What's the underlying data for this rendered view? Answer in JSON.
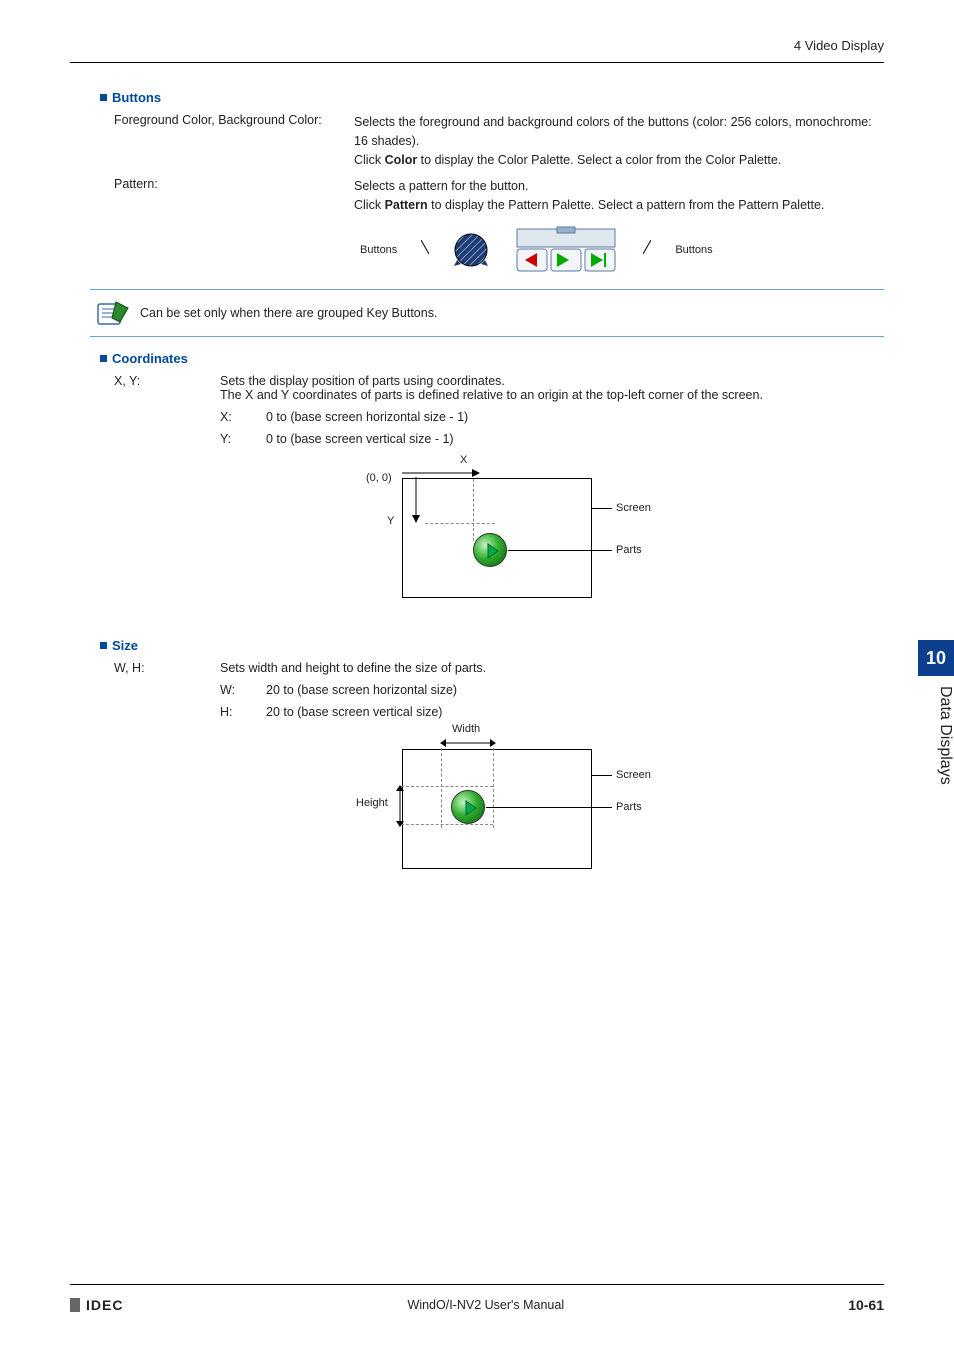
{
  "header": {
    "section": "4 Video Display"
  },
  "tab": {
    "number": "10",
    "title": "Data Displays"
  },
  "buttons": {
    "heading": "Buttons",
    "fg_bg_label": "Foreground Color, Background Color:",
    "fg_bg_desc1": "Selects the foreground and background colors of the buttons (color: 256 colors, monochrome: 16 shades).",
    "fg_bg_desc2_a": "Click ",
    "fg_bg_desc2_b": "Color",
    "fg_bg_desc2_c": " to display the Color Palette. Select a color from the Color Palette.",
    "pattern_label": "Pattern:",
    "pattern_desc1": "Selects a pattern for the button.",
    "pattern_desc2_a": "Click ",
    "pattern_desc2_b": "Pattern",
    "pattern_desc2_c": " to display the Pattern Palette. Select a pattern from the Pattern Palette.",
    "fig_label_left": "Buttons",
    "fig_label_right": "Buttons",
    "note": "Can be set only when there are grouped Key Buttons."
  },
  "coordinates": {
    "heading": "Coordinates",
    "label": "X, Y:",
    "desc1": "Sets the display position of parts using coordinates.",
    "desc2": "The X and Y coordinates of parts is defined relative to an origin at the top-left corner of the screen.",
    "x_label": "X:",
    "x_range": "0 to (base screen horizontal size - 1)",
    "y_label": "Y:",
    "y_range": "0 to (base screen vertical size - 1)",
    "diag_origin": "(0, 0)",
    "diag_x": "X",
    "diag_y": "Y",
    "diag_screen": "Screen",
    "diag_parts": "Parts"
  },
  "size": {
    "heading": "Size",
    "label": "W, H:",
    "desc1": "Sets width and height to define the size of parts.",
    "w_label": "W:",
    "w_range": "20 to (base screen horizontal size)",
    "h_label": "H:",
    "h_range": "20 to (base screen vertical size)",
    "diag_width": "Width",
    "diag_height": "Height",
    "diag_screen": "Screen",
    "diag_parts": "Parts"
  },
  "footer": {
    "brand": "IDEC",
    "center": "WindO/I-NV2 User's Manual",
    "page": "10-61"
  }
}
